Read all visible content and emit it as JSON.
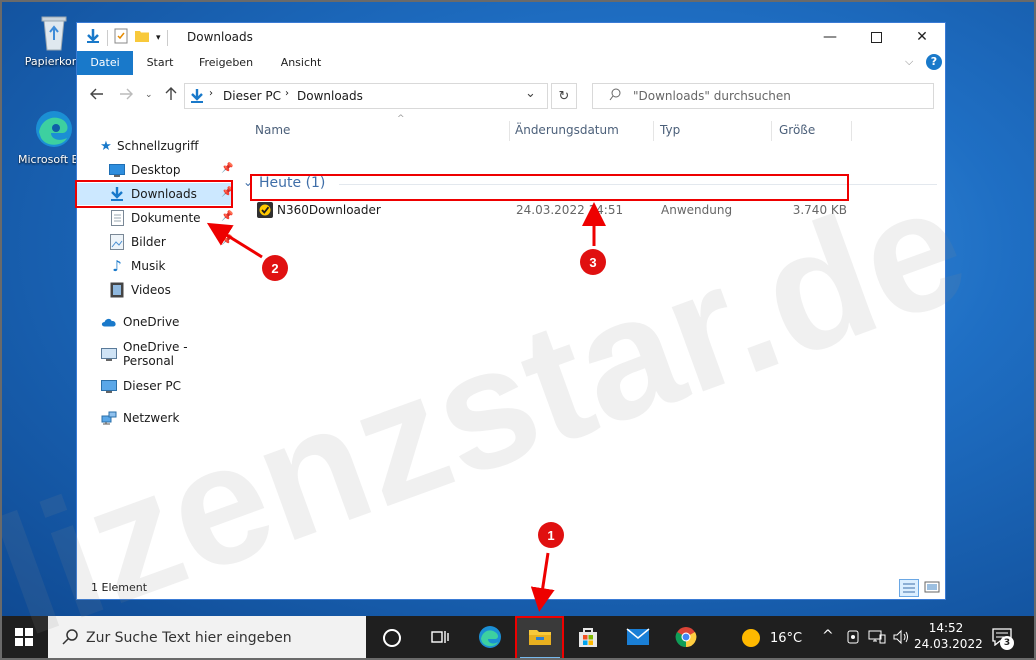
{
  "desktop": {
    "icons": [
      {
        "label": "Papierkorb"
      },
      {
        "label": "Microsoft Edge"
      }
    ]
  },
  "window": {
    "title": "Downloads",
    "ribbon_tabs": [
      "Datei",
      "Start",
      "Freigeben",
      "Ansicht"
    ],
    "address": {
      "segments": [
        "Dieser PC",
        "Downloads"
      ]
    },
    "search_placeholder": "\"Downloads\" durchsuchen",
    "nav": {
      "quick_access": "Schnellzugriff",
      "quick_items": [
        "Desktop",
        "Downloads",
        "Dokumente",
        "Bilder",
        "Musik",
        "Videos"
      ],
      "onedrive": "OneDrive",
      "onedrive_personal": "OneDrive - Personal",
      "this_pc": "Dieser PC",
      "network": "Netzwerk"
    },
    "columns": [
      "Name",
      "Änderungsdatum",
      "Typ",
      "Größe"
    ],
    "group_label": "Heute (1)",
    "files": [
      {
        "name": "N360Downloader",
        "date": "24.03.2022 14:51",
        "type": "Anwendung",
        "size": "3.740 KB"
      }
    ],
    "status": "1 Element"
  },
  "taskbar": {
    "search_placeholder": "Zur Suche Text hier eingeben",
    "weather": "16°C",
    "time": "14:52",
    "date": "24.03.2022",
    "notification_count": "3"
  },
  "annotations": {
    "badges": [
      "1",
      "2",
      "3"
    ],
    "color": "#e00000"
  },
  "watermark": "lizenzstar.de",
  "colors": {
    "accent": "#1979ca",
    "folder": "#f8c93b",
    "taskbar": "#1f1f1f"
  }
}
